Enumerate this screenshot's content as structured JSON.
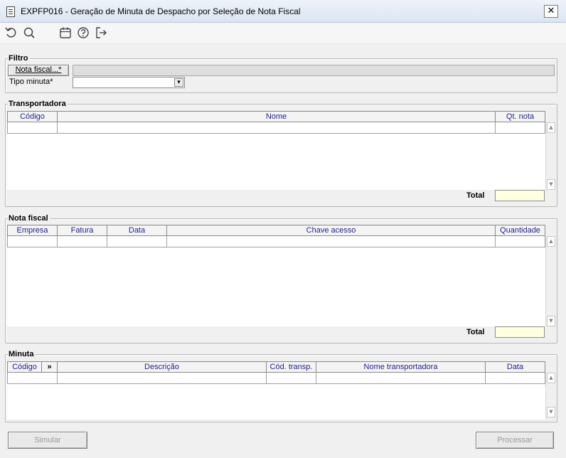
{
  "window": {
    "title": "EXPFP016 - Geração de Minuta de Despacho por Seleção de Nota Fiscal",
    "close_glyph": "✕"
  },
  "toolbar": {
    "icons": [
      "undo-icon",
      "search-icon",
      "calendar-icon",
      "help-icon",
      "exit-icon"
    ]
  },
  "filtro": {
    "legend": "Filtro",
    "nota_fiscal_button": "Nota fiscal...*",
    "nota_fiscal_value": "",
    "tipo_minuta_label": "Tipo minuta*",
    "tipo_minuta_value": "",
    "dropdown_glyph": "▾"
  },
  "transportadora": {
    "legend": "Transportadora",
    "columns": [
      "Código",
      "Nome",
      "Qt. nota"
    ],
    "total_label": "Total",
    "total_value": ""
  },
  "nota_fiscal": {
    "legend": "Nota fiscal",
    "columns": [
      "Empresa",
      "Fatura",
      "Data",
      "Chave acesso",
      "Quantidade"
    ],
    "total_label": "Total",
    "total_value": ""
  },
  "minuta": {
    "legend": "Minuta",
    "columns": [
      "Código",
      "»",
      "Descrição",
      "Cód. transp.",
      "Nome transportadora",
      "Data"
    ]
  },
  "actions": {
    "simular": "Simular",
    "processar": "Processar"
  },
  "scroll": {
    "up": "▲",
    "down": "▼"
  },
  "colors": {
    "title_bar": "#dbe5f2",
    "header_text": "#1f1f8f",
    "total_field": "#ffffe1"
  }
}
